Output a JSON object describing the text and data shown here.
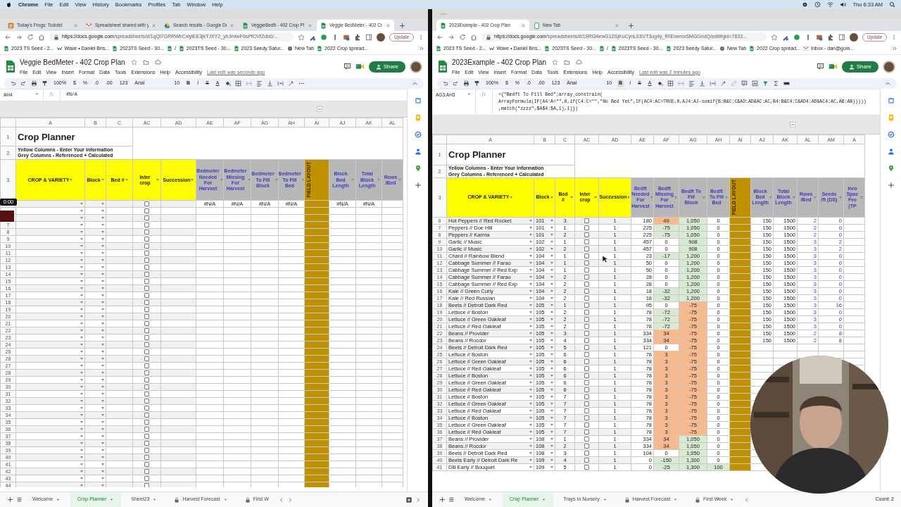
{
  "menubar": {
    "app": "Chrome",
    "menus": [
      "File",
      "Edit",
      "View",
      "History",
      "Bookmarks",
      "Profiles",
      "Tab",
      "Window",
      "Help"
    ],
    "clock": "Thu 6:33 AM"
  },
  "windows": [
    {
      "tabs": [
        {
          "title": "Today's Frogs: Todoist",
          "kind": "task",
          "selected": false
        },
        {
          "title": "Spreadsheet shared with y",
          "kind": "mail",
          "selected": false
        },
        {
          "title": "Search results - Google Dr",
          "kind": "drive",
          "selected": false
        },
        {
          "title": "VeggieBedft - 402 Crop Pl",
          "kind": "sheet",
          "selected": false
        },
        {
          "title": "Veggie BedMeter - 402 Cr",
          "kind": "sheet",
          "selected": true
        }
      ],
      "url_host": "https://docs.google.com",
      "url_path": "/spreadsheets/d/1qQI7GRRWbCxlylEE3jkTJXY2_yhJmiwF0oPfCVfZdb0/...",
      "update": "Update",
      "bookmarks": [
        {
          "label": "2023 TS Seed - 2...",
          "kind": "sheet"
        },
        {
          "label": "Wave • Daniel Bris...",
          "kind": "wave"
        },
        {
          "label": "2023TS Seed - 30...",
          "kind": "sheet"
        },
        {
          "label": "/",
          "kind": "sheet"
        },
        {
          "label": "2023TS Seed - 30...",
          "kind": "sheet"
        },
        {
          "label": "2023 Seedy Satur...",
          "kind": "sheet"
        },
        {
          "label": "New Tab",
          "kind": "globe"
        },
        {
          "label": "2022 Crop spread...",
          "kind": "sheet"
        }
      ],
      "doc": {
        "title": "Veggie BedMeter - 402 Crop Plan",
        "menus": [
          "File",
          "Edit",
          "View",
          "Insert",
          "Format",
          "Data",
          "Tools",
          "Extensions",
          "Help",
          "Accessibility"
        ],
        "last_edit": "Last edit was seconds ago",
        "share": "Share"
      },
      "toolbar": {
        "zoom": "100%",
        "formats": [
          "$",
          "%",
          ".0",
          ".00",
          "123"
        ],
        "font": "Arial",
        "size": "10",
        "styles": [
          {
            "label": "B",
            "kind": "bold",
            "on": false
          },
          {
            "label": "I",
            "kind": "italic",
            "on": false
          },
          {
            "label": "S",
            "kind": "strike",
            "on": false
          },
          {
            "label": "A",
            "kind": "color",
            "on": false
          }
        ]
      },
      "name_box": "AH4",
      "fx": "fx",
      "formula": [
        "#N/A"
      ],
      "sheet": {
        "letters": [
          "A",
          "B",
          "C",
          "AC",
          "AD",
          "AE",
          "AF",
          "AG",
          "AH",
          "AI",
          "AJ",
          "AK",
          "AL"
        ],
        "title": "Crop Planner",
        "legend": [
          "Yellow Columns - Enter Your Information",
          "Grey Columns - Referenced + Calculated"
        ],
        "header_rows": [
          "1",
          "2",
          "3"
        ],
        "columns": [
          {
            "header": "CROP & VARIETY",
            "kind": "choice"
          },
          {
            "header": "Block",
            "kind": "choice"
          },
          {
            "header": "Bed #",
            "kind": "entry"
          },
          {
            "header": "Inter crop",
            "kind": "checkbox"
          },
          {
            "header": "Succession",
            "kind": "entry"
          },
          {
            "header": "Bedmeter Needed For Harvest",
            "kind": "calc"
          },
          {
            "header": "Bedmeter Missing For Harvest",
            "kind": "calc"
          },
          {
            "header": "Bedmeter To Fill Block",
            "kind": "calc"
          },
          {
            "header": "Bedmeter To Fill Bed",
            "kind": "calc"
          },
          {
            "header": "FIELD LAYOUT",
            "kind": "layout"
          },
          {
            "header": "Block Bed Length",
            "kind": "calc"
          },
          {
            "header": "Total Block Length",
            "kind": "calc"
          },
          {
            "header": "Rows /Bed",
            "kind": "calc"
          }
        ],
        "rows": [
          {
            "checked": false,
            "needed": "#N/A",
            "missing": "#N/A",
            "fill_block": "#N/A",
            "fill_bed": "#N/A",
            "bed_length": "#N/A",
            "block_length": "#N/A"
          },
          {
            "checked": false
          },
          {
            "checked": false
          },
          {
            "num": "7",
            "checked": false
          },
          {
            "num": "8",
            "checked": false
          },
          {
            "num": "9",
            "checked": false
          },
          {
            "num": "10",
            "checked": false
          },
          {
            "num": "11",
            "checked": false
          },
          {
            "num": "12",
            "checked": false
          },
          {
            "num": "13",
            "checked": false
          },
          {
            "num": "14",
            "checked": false
          },
          {
            "num": "15",
            "checked": false
          },
          {
            "num": "16",
            "checked": false
          },
          {
            "num": "17",
            "checked": false
          },
          {
            "num": "18",
            "checked": false
          },
          {
            "num": "19",
            "checked": false
          },
          {
            "num": "20",
            "checked": false
          },
          {
            "num": "21",
            "checked": false
          },
          {
            "num": "22",
            "checked": false
          },
          {
            "num": "23",
            "checked": false
          },
          {
            "num": "24",
            "checked": false
          },
          {
            "num": "25",
            "checked": false
          },
          {
            "num": "26",
            "checked": false
          },
          {
            "num": "27",
            "checked": false
          },
          {
            "num": "28",
            "checked": false
          },
          {
            "num": "29",
            "checked": false
          },
          {
            "num": "30",
            "checked": false
          },
          {
            "num": "31",
            "checked": false
          },
          {
            "num": "32",
            "checked": false
          },
          {
            "num": "33",
            "checked": false
          },
          {
            "num": "34",
            "checked": false
          },
          {
            "num": "35",
            "checked": false
          },
          {
            "num": "36",
            "checked": false
          },
          {
            "num": "37",
            "checked": false
          },
          {
            "num": "38",
            "checked": false
          },
          {
            "num": "39",
            "checked": false
          },
          {
            "num": "40",
            "checked": false
          },
          {
            "num": "41",
            "checked": false
          },
          {
            "num": "42",
            "checked": false
          },
          {
            "num": "43",
            "checked": false
          },
          {
            "num": "44",
            "checked": false
          }
        ]
      },
      "sheet_tabs": [
        {
          "label": "Welcome",
          "selected": false,
          "locked": false
        },
        {
          "label": "Crop Planner",
          "selected": true,
          "locked": false
        },
        {
          "label": "Sheet23",
          "selected": false,
          "locked": false
        },
        {
          "label": "Harvest Forecast",
          "selected": false,
          "locked": true
        },
        {
          "label": "First W",
          "selected": false,
          "locked": true
        }
      ],
      "video_timer": "0:00"
    },
    {
      "tabs": [
        {
          "title": "2023Example - 402 Crop Plan",
          "kind": "sheet",
          "selected": true
        },
        {
          "title": "New Tab",
          "kind": "blank",
          "selected": false
        }
      ],
      "url_host": "https://docs.google.com",
      "url_path": "/spreadsheets/d/19Rt34ewG1ZSjKuCynLE6VT3ug4y_flXEnemxSMGGndQ/edit#gid=7833...",
      "update": "Update",
      "bookmarks": [
        {
          "label": "2023 TS Seed - 2...",
          "kind": "sheet"
        },
        {
          "label": "Wave • Daniel Bris...",
          "kind": "wave"
        },
        {
          "label": "2023TS Seed - 30...",
          "kind": "sheet"
        },
        {
          "label": "/",
          "kind": "sheet"
        },
        {
          "label": "2023TS Seed - 30...",
          "kind": "sheet"
        },
        {
          "label": "2023 Seedy Satur...",
          "kind": "sheet"
        },
        {
          "label": "New Tab",
          "kind": "globe"
        },
        {
          "label": "2022 Crop spread...",
          "kind": "sheet"
        },
        {
          "label": "Inbox - dan@goin...",
          "kind": "mail"
        }
      ],
      "doc": {
        "title": "2023Example - 402 Crop Plan",
        "menus": [
          "File",
          "Edit",
          "View",
          "Insert",
          "Format",
          "Data",
          "Tools",
          "Extensions",
          "Help",
          "Accessibility"
        ],
        "last_edit": "Last edit was 2 minutes ago",
        "share": "Share"
      },
      "toolbar": {
        "zoom": "100%",
        "formats": [
          "$",
          "%",
          ".0",
          ".00",
          "123"
        ],
        "font": "Arial",
        "size": "10",
        "styles": [
          {
            "label": "B",
            "kind": "bold",
            "on": true
          },
          {
            "label": "I",
            "kind": "italic",
            "on": false
          },
          {
            "label": "S",
            "kind": "strike",
            "on": false
          },
          {
            "label": "A",
            "kind": "color",
            "on": false
          }
        ]
      },
      "name_box": "AG3:AH3",
      "fx": "fx",
      "formula": [
        "={\"Bedft To Fill Bed\";array_constrain(",
        "ArrayFormula(IF(A4:A=\"\",0,if(C4:C=\"\",\"No Bed Yet\",IF(AC4:AC=TRUE,0,AJ4:AJ-sumif(B:B&C:C&AD:AD&AC:AC,B4:B&C4:C&AD4:AD&AC4:AC,AB:AB)))))",
        ",match(\"zzzz\",$A$4:$A,1),1)})"
      ],
      "sheet": {
        "letters": [
          "A",
          "B",
          "C",
          "AC",
          "AD",
          "AE",
          "AF",
          "AG",
          "AH",
          "AI",
          "AJ",
          "AK",
          "AL",
          "AM",
          "A"
        ],
        "title": "Crop Planner",
        "legend": [
          "Yellow Columns - Enter Your Information",
          "Grey Columns - Referenced + Calculated"
        ],
        "header_rows": [
          "1",
          "2",
          "3"
        ],
        "columns": [
          {
            "header": "CROP & VARIETY",
            "kind": "choice"
          },
          {
            "header": "Block",
            "kind": "choice"
          },
          {
            "header": "Bed #",
            "kind": "entry"
          },
          {
            "header": "Inter crop",
            "kind": "checkbox"
          },
          {
            "header": "Succession",
            "kind": "entry"
          },
          {
            "header": "Bedft Needed For Harvest",
            "kind": "calc"
          },
          {
            "header": "Bedft Missing For Harvest",
            "kind": "calc"
          },
          {
            "header": "Bedft To Fill Block",
            "kind": "calc"
          },
          {
            "header": "Bedft To Fill Bed",
            "kind": "calc"
          },
          {
            "header": "FIELD LAYOUT",
            "kind": "layout"
          },
          {
            "header": "Block Bed Length",
            "kind": "calc"
          },
          {
            "header": "Total Block Length",
            "kind": "calc"
          },
          {
            "header": "Rows /Bed",
            "kind": "calc"
          },
          {
            "header": "Seeds /ft (DS)",
            "kind": "calc"
          },
          {
            "header": "Inro Spac Fee (TP",
            "kind": "calc"
          }
        ],
        "rows": [
          {
            "num": "6",
            "checked": false,
            "crop": "Hot Peppers // Red Rocket",
            "block": "101",
            "bed": "3",
            "succession": "1",
            "needed": "180",
            "missing": {
              "text": "49",
              "color": "#f9b98a"
            },
            "fill_block": {
              "text": "1,050",
              "color": "#d9ead3"
            },
            "fill_bed": "0",
            "bed_length": "150",
            "block_length": "1500",
            "rows_per_bed": "2",
            "seeds_per_ft": "0"
          },
          {
            "num": "7",
            "checked": false,
            "crop": "Peppers // Doe Hill",
            "block": "101",
            "bed": "1",
            "succession": "1",
            "needed": "225",
            "missing": {
              "text": "-75",
              "color": "#d9ead3"
            },
            "fill_block": {
              "text": "1,050",
              "color": "#d9ead3"
            },
            "fill_bed": "0",
            "bed_length": "150",
            "block_length": "1500",
            "rows_per_bed": "2",
            "seeds_per_ft": "0"
          },
          {
            "num": "8",
            "checked": false,
            "crop": "Peppers // Karma",
            "block": "101",
            "bed": "2",
            "succession": "1",
            "needed": "225",
            "missing": {
              "text": "-75",
              "color": "#d9ead3"
            },
            "fill_block": {
              "text": "1,050",
              "color": "#d9ead3"
            },
            "fill_bed": "0",
            "bed_length": "150",
            "block_length": "1500",
            "rows_per_bed": "2",
            "seeds_per_ft": "0"
          },
          {
            "num": "9",
            "checked": false,
            "crop": "Garlic // Music",
            "block": "102",
            "bed": "1",
            "succession": "1",
            "needed": "457",
            "missing": "0",
            "fill_block": {
              "text": "908",
              "color": "#d9ead3"
            },
            "fill_bed": "0",
            "bed_length": "150",
            "block_length": "1500",
            "rows_per_bed": "3",
            "seeds_per_ft": "2"
          },
          {
            "num": "10",
            "checked": false,
            "crop": "Garlic // Music",
            "block": "102",
            "bed": "2",
            "succession": "1",
            "needed": "457",
            "missing": "0",
            "fill_block": {
              "text": "908",
              "color": "#d9ead3"
            },
            "fill_bed": "0",
            "bed_length": "150",
            "block_length": "1500",
            "rows_per_bed": "3",
            "seeds_per_ft": "2"
          },
          {
            "num": "11",
            "checked": false,
            "crop": "Chard // Rainbow Blend",
            "block": "104",
            "bed": "1",
            "succession": "1",
            "needed": "23",
            "missing": {
              "text": "-17",
              "color": "#d9ead3"
            },
            "fill_block": {
              "text": "1,200",
              "color": "#d9ead3"
            },
            "fill_bed": "0",
            "bed_length": "150",
            "block_length": "1500",
            "rows_per_bed": "3",
            "seeds_per_ft": "0"
          },
          {
            "num": "12",
            "checked": false,
            "crop": "Cabbage Summer // Farao",
            "block": "104",
            "bed": "1",
            "succession": "1",
            "needed": "50",
            "missing": "0",
            "fill_block": {
              "text": "1,200",
              "color": "#d9ead3"
            },
            "fill_bed": "0",
            "bed_length": "150",
            "block_length": "1500",
            "rows_per_bed": "3",
            "seeds_per_ft": "0"
          },
          {
            "num": "13",
            "checked": false,
            "crop": "Cabbage Summer // Red Exp",
            "block": "104",
            "bed": "1",
            "succession": "1",
            "needed": "50",
            "missing": "0",
            "fill_block": {
              "text": "1,200",
              "color": "#d9ead3"
            },
            "fill_bed": "0",
            "bed_length": "150",
            "block_length": "1500",
            "rows_per_bed": "3",
            "seeds_per_ft": "0"
          },
          {
            "num": "14",
            "checked": false,
            "crop": "Cabbage Summer // Farao",
            "block": "104",
            "bed": "2",
            "succession": "1",
            "needed": "28",
            "missing": "0",
            "fill_block": {
              "text": "1,200",
              "color": "#d9ead3"
            },
            "fill_bed": "0",
            "bed_length": "150",
            "block_length": "1500",
            "rows_per_bed": "3",
            "seeds_per_ft": "0"
          },
          {
            "num": "15",
            "checked": false,
            "crop": "Cabbage Summer // Red Exp",
            "block": "104",
            "bed": "2",
            "succession": "1",
            "needed": "28",
            "missing": "0",
            "fill_block": {
              "text": "1,200",
              "color": "#d9ead3"
            },
            "fill_bed": "0",
            "bed_length": "150",
            "block_length": "1500",
            "rows_per_bed": "3",
            "seeds_per_ft": "0"
          },
          {
            "num": "16",
            "checked": false,
            "crop": "Kale // Green Curly",
            "block": "104",
            "bed": "2",
            "succession": "1",
            "needed": "18",
            "missing": {
              "text": "-32",
              "color": "#d9ead3"
            },
            "fill_block": {
              "text": "1,200",
              "color": "#d9ead3"
            },
            "fill_bed": "0",
            "bed_length": "150",
            "block_length": "1500",
            "rows_per_bed": "3",
            "seeds_per_ft": "0"
          },
          {
            "num": "17",
            "checked": false,
            "crop": "Kale // Red Russian",
            "block": "104",
            "bed": "2",
            "succession": "1",
            "needed": "18",
            "missing": {
              "text": "-32",
              "color": "#d9ead3"
            },
            "fill_block": {
              "text": "1,200",
              "color": "#d9ead3"
            },
            "fill_bed": "0",
            "bed_length": "150",
            "block_length": "1500",
            "rows_per_bed": "3",
            "seeds_per_ft": "0"
          },
          {
            "num": "18",
            "checked": false,
            "crop": "Beets // Detroit Dark Red",
            "block": "105",
            "bed": "1",
            "succession": "1",
            "needed": "95",
            "missing": "0",
            "fill_block": {
              "text": "-75",
              "color": "#f9b98a"
            },
            "fill_bed": "0",
            "bed_length": "150",
            "block_length": "1500",
            "rows_per_bed": "3",
            "seeds_per_ft": "16"
          },
          {
            "num": "19",
            "checked": false,
            "crop": "Lettuce // Boston",
            "block": "105",
            "bed": "2",
            "succession": "1",
            "needed": "78",
            "missing": {
              "text": "-72",
              "color": "#d9ead3"
            },
            "fill_block": {
              "text": "-75",
              "color": "#f9b98a"
            },
            "fill_bed": "0",
            "bed_length": "150",
            "block_length": "1500",
            "rows_per_bed": "3",
            "seeds_per_ft": "0"
          },
          {
            "num": "20",
            "checked": false,
            "crop": "Lettuce // Green Oakleaf",
            "block": "105",
            "bed": "2",
            "succession": "1",
            "needed": "78",
            "missing": {
              "text": "-72",
              "color": "#d9ead3"
            },
            "fill_block": {
              "text": "-75",
              "color": "#f9b98a"
            },
            "fill_bed": "0",
            "bed_length": "150",
            "block_length": "1500",
            "rows_per_bed": "3",
            "seeds_per_ft": "0"
          },
          {
            "num": "21",
            "checked": false,
            "crop": "Lettuce // Red Oakleaf",
            "block": "105",
            "bed": "2",
            "succession": "1",
            "needed": "78",
            "missing": {
              "text": "-72",
              "color": "#d9ead3"
            },
            "fill_block": {
              "text": "-75",
              "color": "#f9b98a"
            },
            "fill_bed": "0",
            "bed_length": "150",
            "block_length": "1500",
            "rows_per_bed": "3",
            "seeds_per_ft": "0"
          },
          {
            "num": "22",
            "checked": false,
            "crop": "Beans // Provider",
            "block": "105",
            "bed": "3",
            "succession": "1",
            "needed": "334",
            "missing": {
              "text": "34",
              "color": "#f9b98a"
            },
            "fill_block": {
              "text": "-75",
              "color": "#f9b98a"
            },
            "fill_bed": "0",
            "bed_length": "150",
            "block_length": "1500",
            "rows_per_bed": "2",
            "seeds_per_ft": "8"
          },
          {
            "num": "23",
            "checked": false,
            "crop": "Beans // Rocdor",
            "block": "105",
            "bed": "4",
            "succession": "1",
            "needed": "334",
            "missing": {
              "text": "34",
              "color": "#f9b98a"
            },
            "fill_block": {
              "text": "-75",
              "color": "#f9b98a"
            },
            "fill_bed": "0",
            "bed_length": "150",
            "block_length": "1500",
            "rows_per_bed": "2",
            "seeds_per_ft": "8"
          },
          {
            "num": "24",
            "checked": false,
            "crop": "Beets // Detroit Dark Red",
            "block": "105",
            "bed": "5",
            "succession": "1",
            "needed": "121",
            "missing": "0",
            "fill_block": {
              "text": "-75",
              "color": "#f9b98a"
            },
            "fill_bed": "0"
          },
          {
            "num": "25",
            "checked": false,
            "crop": "Lettuce // Boston",
            "block": "105",
            "bed": "6",
            "succession": "1",
            "needed": "78",
            "missing": {
              "text": "3",
              "color": "#f9b98a"
            },
            "fill_block": {
              "text": "-75",
              "color": "#f9b98a"
            },
            "fill_bed": "0"
          },
          {
            "num": "26",
            "checked": false,
            "crop": "Lettuce // Green Oakleaf",
            "block": "105",
            "bed": "6",
            "succession": "1",
            "needed": "78",
            "missing": {
              "text": "3",
              "color": "#f9b98a"
            },
            "fill_block": {
              "text": "-75",
              "color": "#f9b98a"
            },
            "fill_bed": "0"
          },
          {
            "num": "27",
            "checked": false,
            "crop": "Lettuce // Red Oakleaf",
            "block": "105",
            "bed": "6",
            "succession": "1",
            "needed": "78",
            "missing": {
              "text": "3",
              "color": "#f9b98a"
            },
            "fill_block": {
              "text": "-75",
              "color": "#f9b98a"
            },
            "fill_bed": "0"
          },
          {
            "num": "28",
            "checked": false,
            "crop": "Lettuce // Boston",
            "block": "105",
            "bed": "6",
            "succession": "1",
            "needed": "78",
            "missing": {
              "text": "3",
              "color": "#f9b98a"
            },
            "fill_block": {
              "text": "-75",
              "color": "#f9b98a"
            },
            "fill_bed": "0"
          },
          {
            "num": "29",
            "checked": false,
            "crop": "Lettuce // Green Oakleaf",
            "block": "105",
            "bed": "6",
            "succession": "1",
            "needed": "78",
            "missing": {
              "text": "3",
              "color": "#f9b98a"
            },
            "fill_block": {
              "text": "-75",
              "color": "#f9b98a"
            },
            "fill_bed": "0"
          },
          {
            "num": "30",
            "checked": false,
            "crop": "Lettuce // Red Oakleaf",
            "block": "105",
            "bed": "6",
            "succession": "1",
            "needed": "78",
            "missing": {
              "text": "3",
              "color": "#f9b98a"
            },
            "fill_block": {
              "text": "-75",
              "color": "#f9b98a"
            },
            "fill_bed": "0"
          },
          {
            "num": "31",
            "checked": false,
            "crop": "Lettuce // Boston",
            "block": "105",
            "bed": "7",
            "succession": "1",
            "needed": "78",
            "missing": {
              "text": "3",
              "color": "#f9b98a"
            },
            "fill_block": {
              "text": "-75",
              "color": "#f9b98a"
            },
            "fill_bed": "0"
          },
          {
            "num": "32",
            "checked": false,
            "crop": "Lettuce // Green Oakleaf",
            "block": "105",
            "bed": "7",
            "succession": "1",
            "needed": "78",
            "missing": {
              "text": "3",
              "color": "#f9b98a"
            },
            "fill_block": {
              "text": "-75",
              "color": "#f9b98a"
            },
            "fill_bed": "0"
          },
          {
            "num": "33",
            "checked": false,
            "crop": "Lettuce // Red Oakleaf",
            "block": "105",
            "bed": "7",
            "succession": "1",
            "needed": "78",
            "missing": {
              "text": "3",
              "color": "#f9b98a"
            },
            "fill_block": {
              "text": "-75",
              "color": "#f9b98a"
            },
            "fill_bed": "0"
          },
          {
            "num": "34",
            "checked": false,
            "crop": "Lettuce // Boston",
            "block": "105",
            "bed": "7",
            "succession": "1",
            "needed": "78",
            "missing": {
              "text": "3",
              "color": "#f9b98a"
            },
            "fill_block": {
              "text": "-75",
              "color": "#f9b98a"
            },
            "fill_bed": "0"
          },
          {
            "num": "35",
            "checked": false,
            "crop": "Lettuce // Green Oakleaf",
            "block": "105",
            "bed": "7",
            "succession": "1",
            "needed": "78",
            "missing": {
              "text": "3",
              "color": "#f9b98a"
            },
            "fill_block": {
              "text": "-75",
              "color": "#f9b98a"
            },
            "fill_bed": "0"
          },
          {
            "num": "36",
            "checked": false,
            "crop": "Lettuce // Red Oakleaf",
            "block": "105",
            "bed": "7",
            "succession": "1",
            "needed": "78",
            "missing": {
              "text": "3",
              "color": "#f9b98a"
            },
            "fill_block": {
              "text": "-75",
              "color": "#f9b98a"
            },
            "fill_bed": "0"
          },
          {
            "num": "37",
            "checked": false,
            "crop": "Beans // Provider",
            "block": "108",
            "bed": "1",
            "succession": "1",
            "needed": "334",
            "missing": {
              "text": "34",
              "color": "#f9b98a"
            },
            "fill_block": {
              "text": "1,050",
              "color": "#d9ead3"
            },
            "fill_bed": "0"
          },
          {
            "num": "38",
            "checked": false,
            "crop": "Beans // Rocdor",
            "block": "108",
            "bed": "2",
            "succession": "1",
            "needed": "334",
            "missing": {
              "text": "34",
              "color": "#f9b98a"
            },
            "fill_block": {
              "text": "1,050",
              "color": "#d9ead3"
            },
            "fill_bed": "0"
          },
          {
            "num": "39",
            "checked": false,
            "crop": "Beets // Detroit Dark Red",
            "block": "108",
            "bed": "3",
            "succession": "1",
            "needed": "104",
            "missing": "0",
            "fill_block": {
              "text": "1,050",
              "color": "#d9ead3"
            },
            "fill_bed": "0"
          },
          {
            "num": "40",
            "checked": false,
            "crop": "Beets Early // Detroit Dark Re",
            "block": "109",
            "bed": "4",
            "succession": "1",
            "needed": "0",
            "missing": {
              "text": "-150",
              "color": "#d9ead3"
            },
            "fill_block": {
              "text": "1,300",
              "color": "#d9ead3"
            },
            "fill_bed": "0"
          },
          {
            "num": "41",
            "checked": false,
            "crop": "Dill Early // Bouquet",
            "block": "109",
            "bed": "5",
            "succession": "1",
            "needed": "0",
            "missing": {
              "text": "-25",
              "color": "#d9ead3"
            },
            "fill_block": {
              "text": "1,300",
              "color": "#d9ead3"
            },
            "fill_bed": {
              "text": "100",
              "color": "#d9ead3"
            }
          }
        ]
      },
      "sheet_tabs": [
        {
          "label": "Welcome",
          "selected": false,
          "locked": false
        },
        {
          "label": "Crop Planner",
          "selected": true,
          "locked": false
        },
        {
          "label": "Trays In Nursery",
          "selected": false,
          "locked": false
        },
        {
          "label": "Harvest Forecast",
          "selected": false,
          "locked": true
        },
        {
          "label": "First Week",
          "selected": false,
          "locked": true
        }
      ],
      "status": "Count: 2"
    }
  ]
}
